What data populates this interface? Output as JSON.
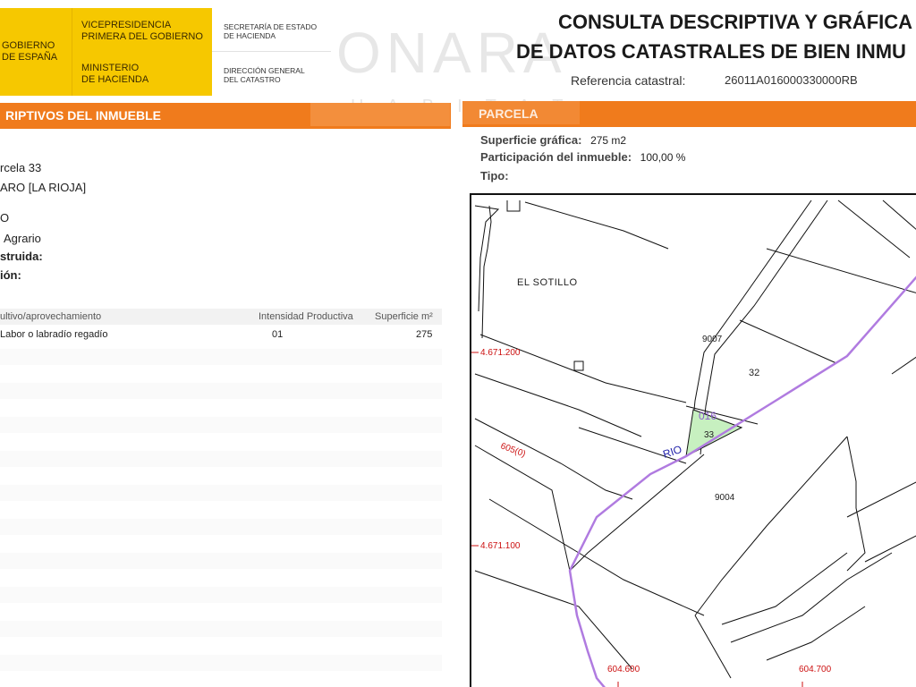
{
  "header": {
    "gov_line1": "GOBIERNO",
    "gov_line2": "DE ESPAÑA",
    "vice_line1": "VICEPRESIDENCIA",
    "vice_line2": "PRIMERA DEL GOBIERNO",
    "min_line1": "MINISTERIO",
    "min_line2": "DE HACIENDA",
    "sec_line1": "SECRETARÍA DE ESTADO",
    "sec_line2": "DE HACIENDA",
    "dir_line1": "DIRECCIÓN GENERAL",
    "dir_line2": "DEL CATASTRO",
    "title_line1": "CONSULTA DESCRIPTIVA Y GRÁFICA",
    "title_line2": "DE DATOS CATASTRALES DE BIEN INMU",
    "ref_label": "Referencia catastral:",
    "ref_value": "26011A016000330000RB",
    "watermark": "ONARA",
    "watermark_sub": "HABITAT"
  },
  "left_section": {
    "title": "RIPTIVOS DEL INMUEBLE",
    "fields": [
      "rcela 33",
      "ARO [LA RIOJA]",
      "O",
      "Agrario",
      "struida:",
      "ión:"
    ],
    "table": {
      "headers": [
        "ultivo/aprovechamiento",
        "Intensidad Productiva",
        "Superficie m²"
      ],
      "rows": [
        {
          "cultivo": "Labor o labradío regadío",
          "intensidad": "01",
          "superficie": "275"
        }
      ]
    }
  },
  "right_section": {
    "title": "PARCELA",
    "superficie_label": "Superficie gráfica:",
    "superficie_value": "275 m2",
    "participacion_label": "Participación del inmueble:",
    "participacion_value": "100,00 %",
    "tipo_label": "Tipo:"
  },
  "map": {
    "place_name": "EL SOTILLO",
    "river_label": "RIO",
    "parcels": [
      "9007",
      "32",
      "33",
      "9004"
    ],
    "polygon_label": "016",
    "coord_labels": [
      "4.671.200",
      "4.671.100",
      "604.600",
      "604.700",
      "605(0)"
    ],
    "colors": {
      "river": "#b07be0",
      "highlight": "#c7f0c0",
      "coords": "#cc1111",
      "polygon": "#8a5cc9"
    }
  }
}
